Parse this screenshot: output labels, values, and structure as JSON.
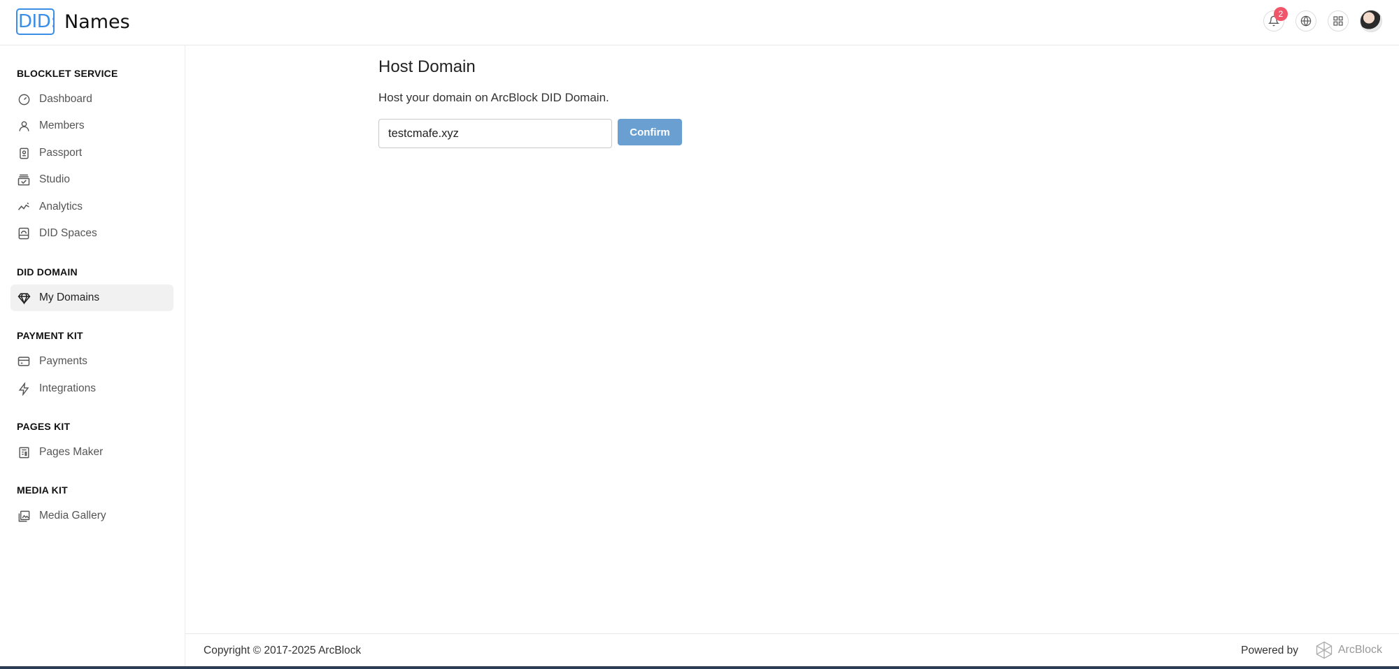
{
  "header": {
    "logo_text": "DID:",
    "app_name": "Names",
    "notification_count": "2"
  },
  "sidebar": {
    "sections": [
      {
        "title": "BLOCKLET SERVICE",
        "items": [
          {
            "label": "Dashboard",
            "icon": "gauge-icon"
          },
          {
            "label": "Members",
            "icon": "user-icon"
          },
          {
            "label": "Passport",
            "icon": "passport-icon"
          },
          {
            "label": "Studio",
            "icon": "studio-icon"
          },
          {
            "label": "Analytics",
            "icon": "analytics-icon"
          },
          {
            "label": "DID Spaces",
            "icon": "drive-icon"
          }
        ]
      },
      {
        "title": "DID DOMAIN",
        "items": [
          {
            "label": "My Domains",
            "icon": "diamond-icon",
            "active": true
          }
        ]
      },
      {
        "title": "PAYMENT KIT",
        "items": [
          {
            "label": "Payments",
            "icon": "credit-card-icon"
          },
          {
            "label": "Integrations",
            "icon": "lightning-icon"
          }
        ]
      },
      {
        "title": "PAGES KIT",
        "items": [
          {
            "label": "Pages Maker",
            "icon": "newspaper-icon"
          }
        ]
      },
      {
        "title": "MEDIA KIT",
        "items": [
          {
            "label": "Media Gallery",
            "icon": "gallery-icon"
          }
        ]
      }
    ]
  },
  "main": {
    "title": "Host Domain",
    "description": "Host your domain on ArcBlock DID Domain.",
    "domain_input_value": "testcmafe.xyz",
    "confirm_label": "Confirm"
  },
  "footer": {
    "copyright": "Copyright © 2017-2025  ArcBlock",
    "powered_by": "Powered by",
    "brand": "ArcBlock"
  }
}
